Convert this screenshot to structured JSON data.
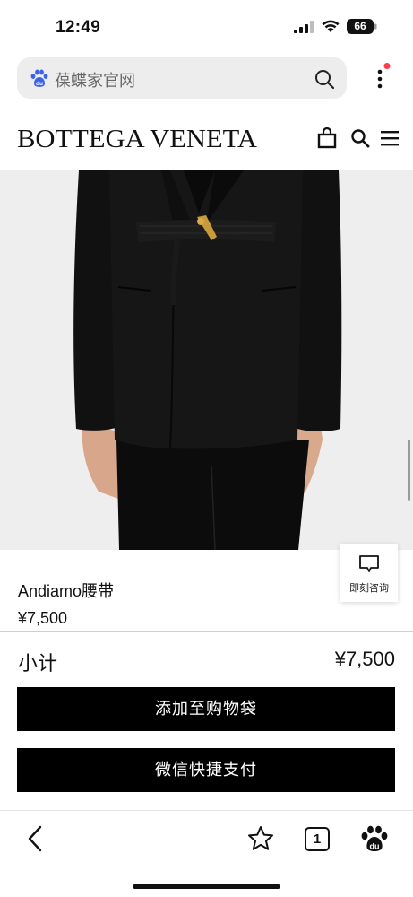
{
  "status_bar": {
    "time": "12:49",
    "battery_level": "66",
    "icons": [
      "signal-icon",
      "wifi-icon",
      "battery-icon"
    ]
  },
  "browser": {
    "address_text": "葆蝶家官网",
    "icons": [
      "baidu-paw-icon",
      "search-icon",
      "more-menu-icon"
    ],
    "notification_dot_color": "#ff3b4d"
  },
  "site": {
    "logo_text": "BOTTEGA VENETA",
    "icons": [
      "shopping-bag-icon",
      "search-icon",
      "hamburger-menu-icon"
    ]
  },
  "product": {
    "name": "Andiamo腰带",
    "price": "¥7,500",
    "consult_label": "即刻咨询"
  },
  "summary": {
    "subtotal_label": "小计",
    "subtotal_value": "¥7,500"
  },
  "actions": {
    "add_to_bag": "添加至购物袋",
    "wechat_pay": "微信快捷支付"
  },
  "bottom_bar": {
    "tabs_count": "1",
    "icons": [
      "back-chevron-icon",
      "star-icon",
      "tabs-icon",
      "baidu-paw-icon"
    ]
  },
  "colors": {
    "button_background": "#000000",
    "image_background": "#eeeeee",
    "address_pill": "#ededed"
  }
}
